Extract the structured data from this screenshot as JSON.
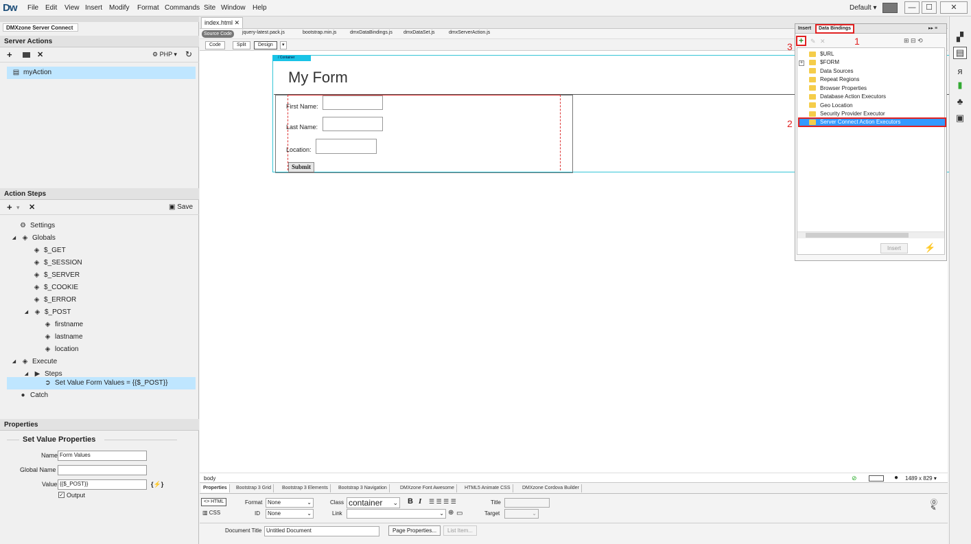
{
  "app": {
    "logo": "Dw",
    "menus": [
      "File",
      "Edit",
      "View",
      "Insert",
      "Modify",
      "Format",
      "Commands",
      "Site",
      "Window",
      "Help"
    ],
    "workspace": "Default",
    "window_controls": [
      "—",
      "☐",
      "✕"
    ]
  },
  "left_panel": {
    "panel_tab": "DMXzone Server Connect",
    "server_actions": {
      "title": "Server Actions",
      "runtime": "PHP",
      "actions": [
        "myAction"
      ]
    },
    "action_steps": {
      "title": "Action Steps",
      "save_label": "Save",
      "tree": [
        {
          "label": "Settings",
          "icon": "gear-icon"
        },
        {
          "label": "Globals",
          "icon": "cube-icon"
        },
        {
          "label": "$_GET",
          "icon": "cube-icon"
        },
        {
          "label": "$_SESSION",
          "icon": "cube-icon"
        },
        {
          "label": "$_SERVER",
          "icon": "cube-icon"
        },
        {
          "label": "$_COOKIE",
          "icon": "cube-icon"
        },
        {
          "label": "$_ERROR",
          "icon": "cube-icon"
        },
        {
          "label": "$_POST",
          "icon": "cube-icon"
        },
        {
          "label": "firstname",
          "icon": "cube-icon"
        },
        {
          "label": "lastname",
          "icon": "cube-icon"
        },
        {
          "label": "location",
          "icon": "cube-icon"
        },
        {
          "label": "Execute",
          "icon": "cube-icon"
        },
        {
          "label": "Steps",
          "icon": "play-icon"
        },
        {
          "label": "Set Value Form Values = {{$_POST}}",
          "icon": "arrow-icon"
        },
        {
          "label": "Catch",
          "icon": "alert-icon"
        }
      ]
    },
    "properties": {
      "title": "Properties",
      "section": "Set Value Properties",
      "name_label": "Name",
      "name_value": "Form Values",
      "global_name_label": "Global Name",
      "global_name_value": "",
      "value_label": "Value",
      "value_value": "{{$_POST}}",
      "output_label": "Output"
    }
  },
  "document": {
    "tab": "index.html",
    "related_files": [
      "Source Code",
      "jquery-latest.pack.js",
      "bootstrap.min.js",
      "dmxDataBindings.js",
      "dmxDataSet.js",
      "dmxServerAction.js"
    ],
    "view_buttons": [
      "Code",
      "Split",
      "Design"
    ],
    "container_tag": "/ Container",
    "form_heading": "My Form",
    "form": {
      "first_name": "First Name:",
      "last_name": "Last Name:",
      "location": "Location:",
      "submit": "Submit"
    },
    "tag_selector": "body",
    "window_size": "1489 x 829"
  },
  "properties_panel": {
    "tabs": [
      "Properties",
      "Bootstrap 3 Grid",
      "Bootstrap 3 Elements",
      "Bootstrap 3 Navigation",
      "DMXzone Font Awesome",
      "HTML5 Animate CSS",
      "DMXzone Cordova Builder"
    ],
    "html_btn": "<> HTML",
    "css_btn": "CSS",
    "format_label": "Format",
    "format_value": "None",
    "class_label": "Class",
    "class_value": "container",
    "id_label": "ID",
    "id_value": "None",
    "link_label": "Link",
    "title_label": "Title",
    "target_label": "Target",
    "doc_title_label": "Document Title",
    "doc_title_value": "Untitled Document",
    "page_properties": "Page Properties...",
    "list_item": "List Item..."
  },
  "data_bindings": {
    "tabs": [
      "Insert",
      "Data Bindings"
    ],
    "items": [
      "$URL",
      "$FORM",
      "Data Sources",
      "Repeat Regions",
      "Browser Properties",
      "Database Action Executors",
      "Geo Location",
      "Security Provider Executor",
      "Server Connect Action Executors"
    ],
    "insert_btn": "Insert",
    "callouts": [
      "1",
      "2",
      "3"
    ]
  },
  "colors": {
    "selection": "#bfe6ff",
    "highlight_blue": "#3399ff",
    "callout_red": "#e02020",
    "folder": "#f5cd4a"
  }
}
